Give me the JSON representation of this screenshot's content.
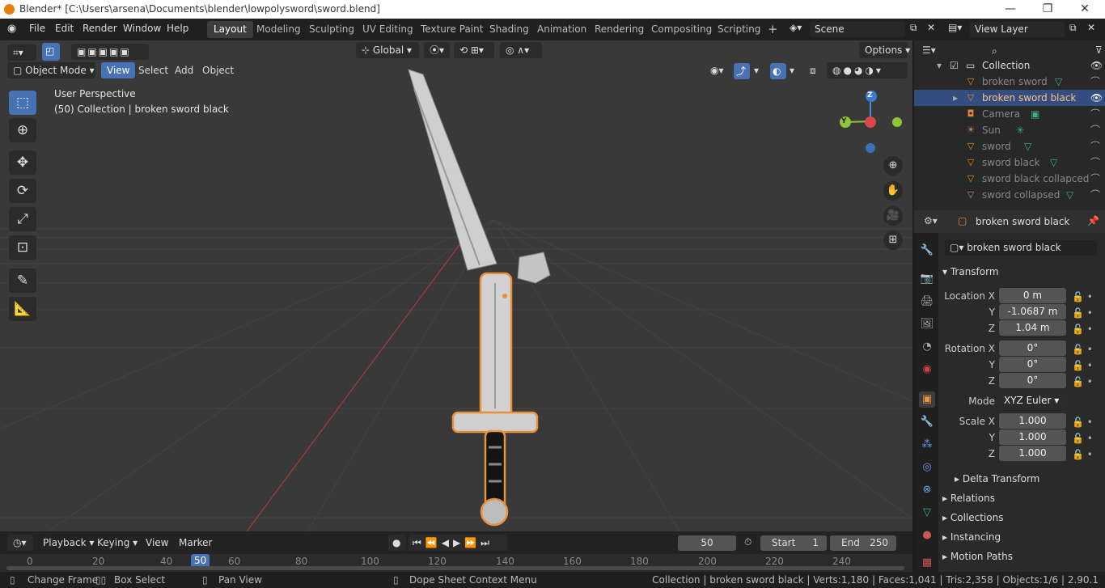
{
  "window": {
    "title": "Blender* [C:\\Users\\arsena\\Documents\\blender\\lowpolysword\\sword.blend]",
    "minimize": "—",
    "maximize": "❐",
    "close": "✕"
  },
  "menu": [
    "File",
    "Edit",
    "Render",
    "Window",
    "Help"
  ],
  "workspaces": [
    "Layout",
    "Modeling",
    "Sculpting",
    "UV Editing",
    "Texture Paint",
    "Shading",
    "Animation",
    "Rendering",
    "Compositing",
    "Scripting"
  ],
  "scene": {
    "name": "Scene",
    "view_layer": "View Layer"
  },
  "viewport": {
    "mode": "Object Mode",
    "menus": [
      "View",
      "Select",
      "Add",
      "Object"
    ],
    "transform_orientation": "Global",
    "options": "Options",
    "overlay_title": "User Perspective",
    "overlay_sub": "(50) Collection | broken sword black",
    "gizmo": {
      "z": "Z",
      "y": "Y"
    }
  },
  "outliner": {
    "collection": "Collection",
    "items": [
      "broken sword",
      "broken sword black",
      "Camera",
      "Sun",
      "sword",
      "sword black",
      "sword black collapced",
      "sword collapsed"
    ],
    "selected": 1
  },
  "properties": {
    "object_name": "broken sword black",
    "object_field": "broken sword black",
    "transform_label": "Transform",
    "location": {
      "label_x": "Location X",
      "x": "0 m",
      "y": "-1.0687 m",
      "z": "1.04 m"
    },
    "rotation": {
      "label_x": "Rotation X",
      "x": "0°",
      "y": "0°",
      "z": "0°"
    },
    "mode_label": "Mode",
    "mode": "XYZ Euler",
    "scale": {
      "label_x": "Scale X",
      "x": "1.000",
      "y": "1.000",
      "z": "1.000"
    },
    "axis_y": "Y",
    "axis_z": "Z",
    "sections": [
      "Delta Transform",
      "Relations",
      "Collections",
      "Instancing",
      "Motion Paths"
    ]
  },
  "timeline": {
    "menus": [
      "Playback",
      "Keying",
      "View",
      "Marker"
    ],
    "current_frame": "50",
    "start_label": "Start",
    "start": "1",
    "end_label": "End",
    "end": "250",
    "ruler": [
      "0",
      "20",
      "40",
      "50",
      "60",
      "80",
      "100",
      "120",
      "140",
      "160",
      "180",
      "200",
      "220",
      "240"
    ]
  },
  "status": {
    "left1": "Change Frame",
    "left2": "Box Select",
    "left3": "Pan View",
    "left4": "Dope Sheet Context Menu",
    "right": "Collection | broken sword black | Verts:1,180 | Faces:1,041 | Tris:2,358 | Objects:1/6 | 2.90.1"
  },
  "colors": {
    "accent": "#4772b3",
    "selection": "#e8923a",
    "viewport_bg": "#393939"
  }
}
